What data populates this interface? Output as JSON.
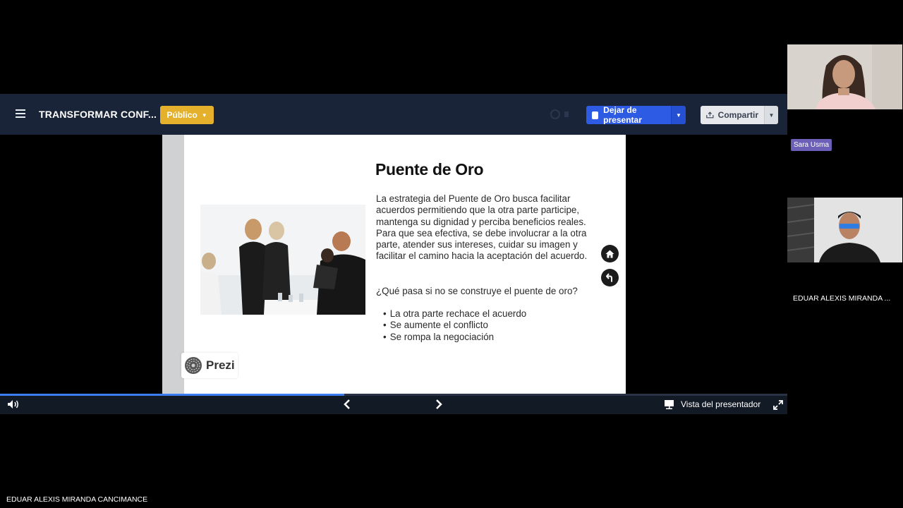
{
  "toolbar": {
    "title": "TRANSFORMAR CONF...",
    "visibility_label": "Público",
    "stop_label": "Dejar de presentar",
    "share_label": "Compartir"
  },
  "slide": {
    "heading": "Puente de Oro",
    "body": "La estrategia del Puente de Oro busca facilitar acuerdos permitiendo que la otra parte participe, mantenga su dignidad y perciba beneficios reales. Para que sea efectiva, se debe involucrar a la otra parte, atender sus intereses, cuidar su imagen y facilitar el camino hacia la aceptación del acuerdo.",
    "question": "¿Qué pasa si no se construye el puente de oro?",
    "bullets": [
      "La otra parte rechace el acuerdo",
      "Se aumente el conflicto",
      "Se rompa la negociación"
    ],
    "logo_text": "Prezi"
  },
  "player": {
    "progress_fraction": 0.437,
    "presenter_view_label": "Vista del presentador"
  },
  "participants": [
    {
      "name": "Sara Usma"
    },
    {
      "name": "EDUAR ALEXIS MIRANDA ..."
    }
  ],
  "self_name": "EDUAR ALEXIS MIRANDA CANCIMANCE",
  "colors": {
    "toolbar_bg": "#1a2438",
    "public_button": "#e5b12c",
    "stop_button": "#2d5be3",
    "progress": "#3d7df0",
    "name_badge": "#6c5fb8"
  },
  "icons": [
    "menu-icon",
    "chevron-down-icon",
    "stop-square-icon",
    "share-upload-icon",
    "home-icon",
    "back-arrow-icon",
    "volume-icon",
    "chevron-left-icon",
    "chevron-right-icon",
    "presenter-view-icon",
    "fullscreen-icon"
  ]
}
